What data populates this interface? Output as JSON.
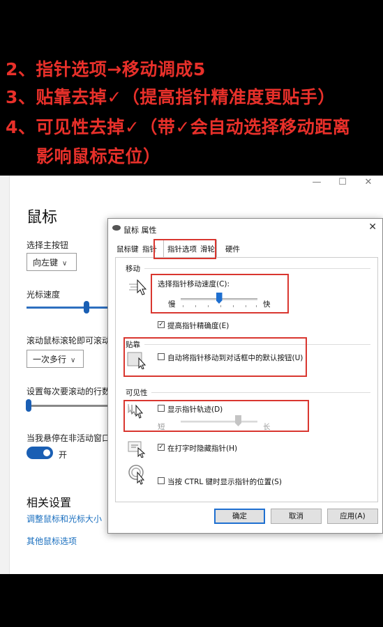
{
  "caption": {
    "line1": "2、指针选项→移动调成5",
    "line2": "3、贴靠去掉✓（提高指针精准度更贴手）",
    "line3": "4、可见性去掉✓（带✓会自动选择移动距离",
    "line4": "影响鼠标定位）"
  },
  "settings": {
    "window_buttons": {
      "minimize": "—",
      "maximize": "☐",
      "close": "✕"
    },
    "title": "鼠标",
    "primary_button_label": "选择主按钮",
    "primary_button_value": "向左键",
    "cursor_speed_label": "光标速度",
    "cursor_speed_level": 0.74,
    "scroll_label": "滚动鼠标滚轮即可滚动",
    "scroll_value": "一次多行",
    "lines_label": "设置每次要滚动的行数",
    "lines_level": 0.03,
    "hover_label": "当我悬停在非活动窗口",
    "toggle_state": "开",
    "related_title": "相关设置",
    "link1": "调整鼠标和光标大小",
    "link2": "其他鼠标选项"
  },
  "dialog": {
    "title": "鼠标 属性",
    "close": "✕",
    "tabs": [
      "鼠标键",
      "指针",
      "指针选项",
      "滑轮",
      "硬件"
    ],
    "active_tab": "指针选项",
    "motion": {
      "group": "移动",
      "label": "选择指针移动速度(C):",
      "slow": "慢",
      "fast": "快",
      "speed_level": 0.5,
      "precision_checked": true,
      "precision_label": "提高指针精确度(E)"
    },
    "snap": {
      "group": "贴靠",
      "checked": false,
      "label": "自动将指针移动到对话框中的默认按钮(U)"
    },
    "visibility": {
      "group": "可见性",
      "trails_checked": false,
      "trails_label": "显示指针轨迹(D)",
      "short": "短",
      "long": "长",
      "trail_level": 0.75,
      "hide_checked": true,
      "hide_label": "在打字时隐藏指针(H)",
      "ctrl_checked": false,
      "ctrl_label": "当按 CTRL 键时显示指针的位置(S)"
    },
    "buttons": {
      "ok": "确定",
      "cancel": "取消",
      "apply": "应用(A)"
    }
  },
  "colors": {
    "highlight": "#d9362f",
    "caption_text": "#e8302a",
    "accent": "#1a5fb4"
  }
}
